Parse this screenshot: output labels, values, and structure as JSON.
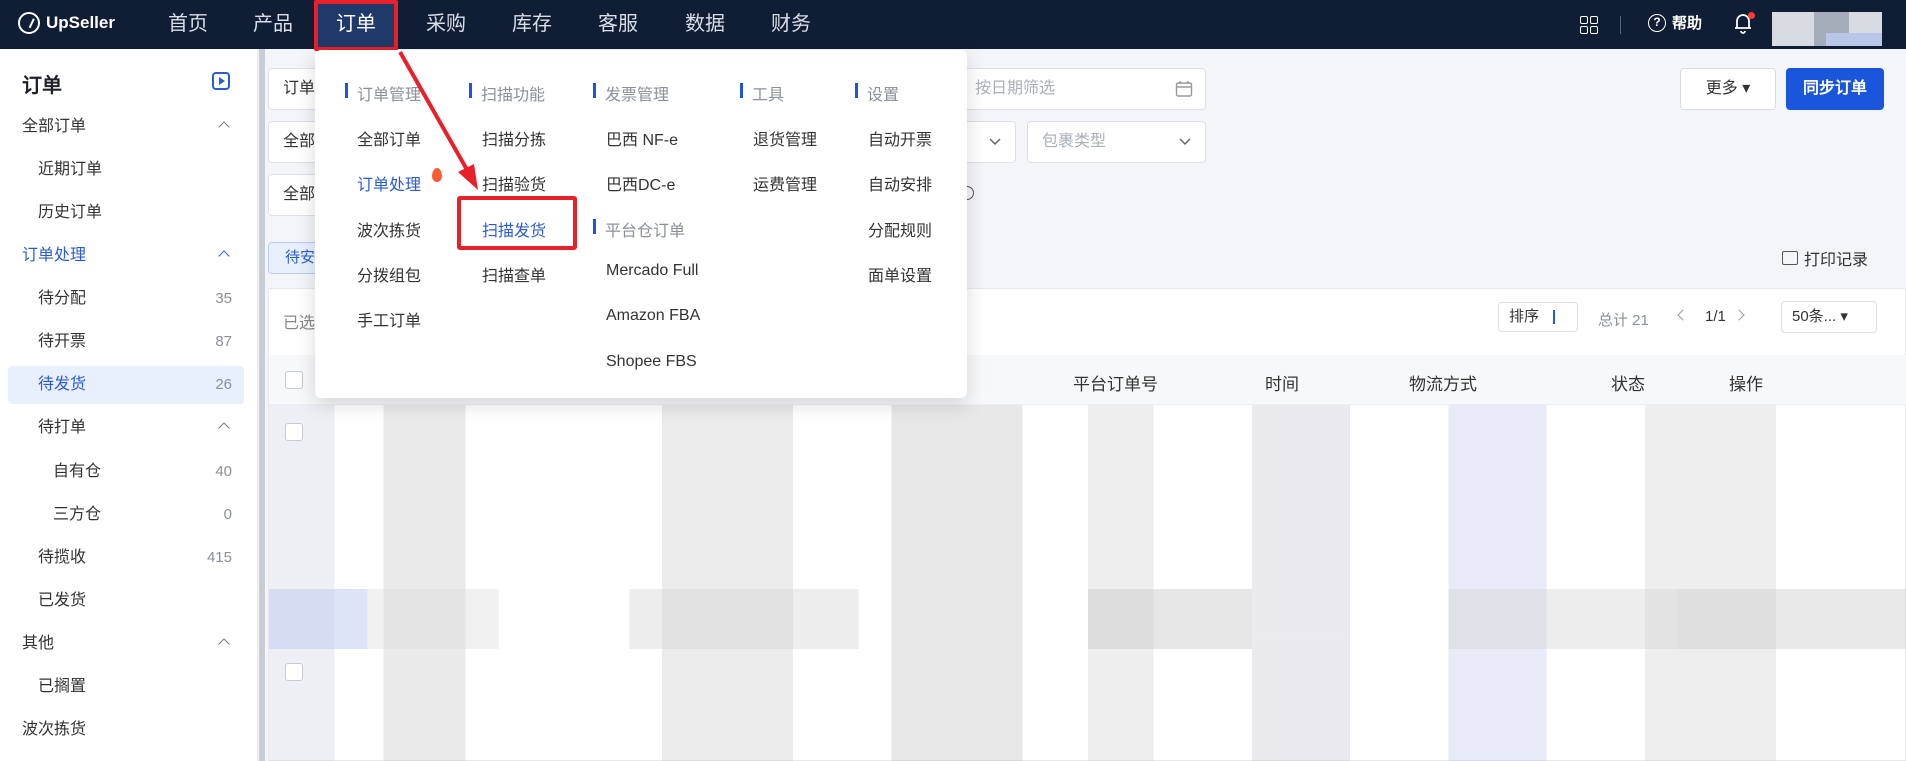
{
  "app": {
    "logo": "UpSeller"
  },
  "nav": {
    "items": [
      "首页",
      "产品",
      "订单",
      "采购",
      "库存",
      "客服",
      "数据",
      "财务"
    ],
    "active": "订单",
    "help": "帮助"
  },
  "sidebar": {
    "title": "订单",
    "items": [
      {
        "label": "全部订单",
        "count": "",
        "level": 1,
        "expanded": true
      },
      {
        "label": "近期订单",
        "count": "",
        "level": 2
      },
      {
        "label": "历史订单",
        "count": "",
        "level": 2
      },
      {
        "label": "订单处理",
        "count": "",
        "level": 1,
        "expanded": true
      },
      {
        "label": "待分配",
        "count": "35",
        "level": 2
      },
      {
        "label": "待开票",
        "count": "87",
        "level": 2
      },
      {
        "label": "待发货",
        "count": "26",
        "level": 2,
        "selected": true
      },
      {
        "label": "待打单",
        "count": "",
        "level": 2,
        "expanded": true
      },
      {
        "label": "自有仓",
        "count": "40",
        "level": 3
      },
      {
        "label": "三方仓",
        "count": "0",
        "level": 3
      },
      {
        "label": "待揽收",
        "count": "415",
        "level": 2
      },
      {
        "label": "已发货",
        "count": "",
        "level": 2
      },
      {
        "label": "其他",
        "count": "",
        "level": 1,
        "expanded": true
      },
      {
        "label": "已搁置",
        "count": "",
        "level": 2
      },
      {
        "label": "波次拣货",
        "count": "",
        "level": 1
      }
    ]
  },
  "filters": {
    "row1_field": "订单",
    "date_placeholder": "按日期筛选",
    "row2_field": "全部",
    "package_placeholder": "包裹类型",
    "row3_field": "全部"
  },
  "actions": {
    "more": "更多",
    "sync": "同步订单"
  },
  "tab_pending": "待安",
  "print_record": "打印记录",
  "table": {
    "selected_text": "已选",
    "sort": "排序",
    "total": "总计 21",
    "page": "1/1",
    "per_page": "50条...",
    "columns": [
      "平台订单号",
      "时间",
      "物流方式",
      "状态",
      "操作"
    ]
  },
  "dropdown": {
    "columns": [
      {
        "header": "订单管理",
        "items": [
          "全部订单",
          "订单处理",
          "波次拣货",
          "分拨组包",
          "手工订单"
        ]
      },
      {
        "header": "扫描功能",
        "items": [
          "扫描分拣",
          "扫描验货",
          "扫描发货",
          "扫描查单"
        ]
      },
      {
        "header": "发票管理",
        "items": [
          "巴西 NF-e",
          "巴西DC-e"
        ]
      },
      {
        "header": "平台仓订单",
        "items": [
          "Mercado Full",
          "Amazon FBA",
          "Shopee FBS"
        ]
      },
      {
        "header": "工具",
        "items": [
          "退货管理",
          "运费管理"
        ]
      },
      {
        "header": "设置",
        "items": [
          "自动开票",
          "自动安排",
          "分配规则",
          "面单设置"
        ]
      }
    ],
    "highlighted": "扫描发货"
  },
  "colors": {
    "nav_bg": "#0f1d35",
    "accent": "#1a56db",
    "annotation": "#e8202a"
  }
}
